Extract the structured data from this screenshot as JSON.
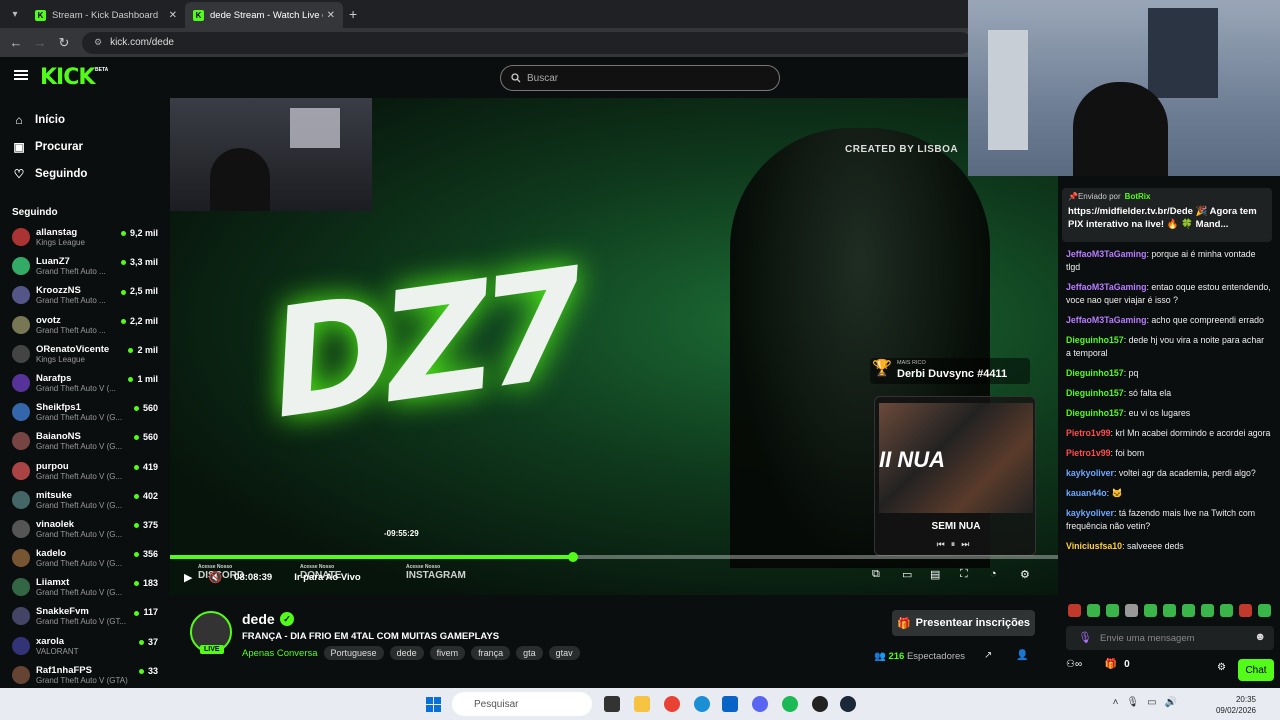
{
  "tabs": [
    {
      "title": "Stream - Kick Dashboard",
      "active": false
    },
    {
      "title": "dede Stream - Watch Live on Kick",
      "active": true
    }
  ],
  "address": {
    "url": "kick.com/dede"
  },
  "header": {
    "logo": "KICK",
    "badge": "BETA",
    "search_placeholder": "Buscar"
  },
  "sidebar": {
    "nav": [
      {
        "label": "Início",
        "icon": "home-icon"
      },
      {
        "label": "Procurar",
        "icon": "browse-icon"
      },
      {
        "label": "Seguindo",
        "icon": "heart-icon"
      }
    ],
    "following_title": "Seguindo",
    "channels": [
      {
        "name": "allanstag",
        "game": "Kings League",
        "viewers": "9,2 mil"
      },
      {
        "name": "LuanZ7",
        "game": "Grand Theft Auto ...",
        "viewers": "3,3 mil"
      },
      {
        "name": "KroozzNS",
        "game": "Grand Theft Auto ...",
        "viewers": "2,5 mil"
      },
      {
        "name": "ovotz",
        "game": "Grand Theft Auto ...",
        "viewers": "2,2 mil"
      },
      {
        "name": "ORenatoVicente",
        "game": "Kings League",
        "viewers": "2 mil"
      },
      {
        "name": "Narafps",
        "game": "Grand Theft Auto V (...",
        "viewers": "1 mil"
      },
      {
        "name": "Sheikfps1",
        "game": "Grand Theft Auto V (G...",
        "viewers": "560"
      },
      {
        "name": "BaianoNS",
        "game": "Grand Theft Auto V (G...",
        "viewers": "560"
      },
      {
        "name": "purpou",
        "game": "Grand Theft Auto V (G...",
        "viewers": "419"
      },
      {
        "name": "mitsuke",
        "game": "Grand Theft Auto V (G...",
        "viewers": "402"
      },
      {
        "name": "vinaolek",
        "game": "Grand Theft Auto V (G...",
        "viewers": "375"
      },
      {
        "name": "kadelo",
        "game": "Grand Theft Auto V (G...",
        "viewers": "356"
      },
      {
        "name": "Liiamxt",
        "game": "Grand Theft Auto V (G...",
        "viewers": "183"
      },
      {
        "name": "SnakkeFvm",
        "game": "Grand Theft Auto V (GT...",
        "viewers": "117"
      },
      {
        "name": "xarola",
        "game": "VALORANT",
        "viewers": "37"
      },
      {
        "name": "Raf1nhaFPS",
        "game": "Grand Theft Auto V (GTA)",
        "viewers": "33"
      }
    ]
  },
  "player": {
    "overlay_created": "CREATED BY LISBOA",
    "logo_text": "DZ7",
    "top_donor_label": "MAIS RICO",
    "top_donor_name": "Derbi Duvsync #4411",
    "music_art_text": "II NUA",
    "music_title": "SEMI NUA",
    "tooltip_time": "-09:55:29",
    "elapsed": "08:08:39",
    "go_live": "Ir para Ao Vivo",
    "progress_fraction": 0.454,
    "banner_discord": "DISCORD",
    "banner_donate": "DONATE",
    "banner_instagram": "INSTAGRAM",
    "banner_sub": "Acesse Nosso"
  },
  "stream": {
    "name": "dede",
    "live_label": "LIVE",
    "title": "FRANÇA - DIA FRIO EM 4TAL COM MUITAS GAMEPLAYS",
    "category": "Apenas Conversa",
    "tags": [
      "Portuguese",
      "dede",
      "fivem",
      "frança",
      "gta",
      "gtav"
    ],
    "gift_button": "Presentear inscrições",
    "viewers_count": "216",
    "viewers_label": "Espectadores"
  },
  "chat": {
    "pinned_by_label": "Enviado por",
    "pinned_by": "BotRix",
    "pinned_text": "https://midfielder.tv.br/Dede 🎉 Agora tem PIX interativo na live! 🔥 🍀 Mand...",
    "messages": [
      {
        "user": "JeffaoM3TaGaming",
        "color": "#b87cff",
        "text": "porque ai é minha vontade tlgd"
      },
      {
        "user": "JeffaoM3TaGaming",
        "color": "#b87cff",
        "text": "entao oque estou entendendo, voce nao quer viajar é isso ?"
      },
      {
        "user": "JeffaoM3TaGaming",
        "color": "#b87cff",
        "text": "acho que compreendi errado"
      },
      {
        "user": "Dieguinho157",
        "color": "#53fc18",
        "text": "dede hj vou vira a noite para achar a temporal"
      },
      {
        "user": "Dieguinho157",
        "color": "#53fc18",
        "text": "pq"
      },
      {
        "user": "Dieguinho157",
        "color": "#53fc18",
        "text": "só falta ela"
      },
      {
        "user": "Dieguinho157",
        "color": "#53fc18",
        "text": "eu vi os lugares"
      },
      {
        "user": "Pietro1v99",
        "color": "#ff4d4d",
        "text": "krl Mn acabei dormindo e acordei agora"
      },
      {
        "user": "Pietro1v99",
        "color": "#ff4d4d",
        "text": "foi bom"
      },
      {
        "user": "kaykyoliver",
        "color": "#6fa8ff",
        "text": "voltei agr da academia, perdi algo?"
      },
      {
        "user": "kauan44o",
        "color": "#6fa8ff",
        "text": "🐱"
      },
      {
        "user": "kaykyoliver",
        "color": "#6fa8ff",
        "text": "tá fazendo mais live na Twitch com frequência não vetin?"
      },
      {
        "user": "Viniciusfsa10",
        "color": "#ffcf3d",
        "text": "salveeee deds"
      }
    ],
    "input_placeholder": "Envie uma mensagem",
    "points": "0",
    "send_label": "Chat"
  },
  "taskbar": {
    "search_placeholder": "Pesquisar",
    "time": "20:35",
    "date": "09/02/2026"
  }
}
